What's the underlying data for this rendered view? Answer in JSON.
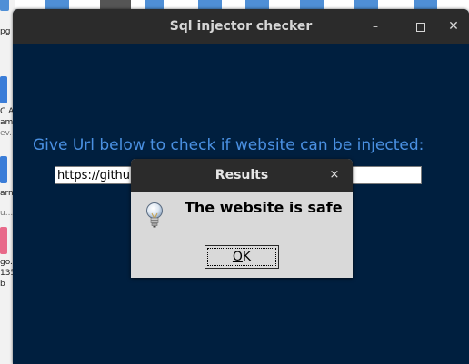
{
  "desktop": {
    "labels": [
      "pg",
      "C A",
      "am",
      "ev...",
      "arn",
      "u...",
      "go.",
      "135",
      "b"
    ]
  },
  "window": {
    "title": "Sql injector checker",
    "minimize_glyph": "–",
    "close_glyph": "✕",
    "prompt": "Give Url below to check if website can be injected:",
    "url_value": "https://github.com"
  },
  "dialog": {
    "title": "Results",
    "close_glyph": "×",
    "message": "The website is safe",
    "ok_label_underlined": "O",
    "ok_label_rest": "K",
    "icon": "lightbulb-icon"
  },
  "colors": {
    "window_bg": "#001f3f",
    "titlebar_bg": "#2b2b2b",
    "prompt_text": "#4a90e2",
    "dialog_bg": "#d9d9d9"
  }
}
